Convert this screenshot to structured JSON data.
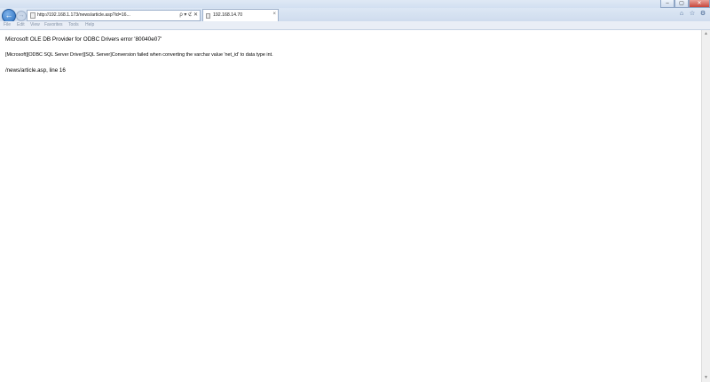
{
  "browser": {
    "address": "http://192.168.1.173/news/article.asp?id=16...",
    "tab_title": "192.168.14.70",
    "tab_close": "×",
    "window_buttons": {
      "minimize": "–",
      "maximize": "▢",
      "close": "✕"
    },
    "nav": {
      "back": "←",
      "forward": "→"
    },
    "address_tools": "ρ ▾ ℭ ✕",
    "right_icons": [
      "⌂",
      "☆",
      "⚙"
    ]
  },
  "menu": {
    "items": [
      "File",
      "Edit",
      "View",
      "Favorites",
      "Tools",
      "Help"
    ]
  },
  "content": {
    "error_title": "Microsoft OLE DB Provider for ODBC Drivers error '80040e07'",
    "error_detail": "[Microsoft][ODBC SQL Server Driver][SQL Server]Conversion failed when converting the varchar value 'net_id' to data type int.",
    "error_location": "/news/article.asp, line 16"
  }
}
